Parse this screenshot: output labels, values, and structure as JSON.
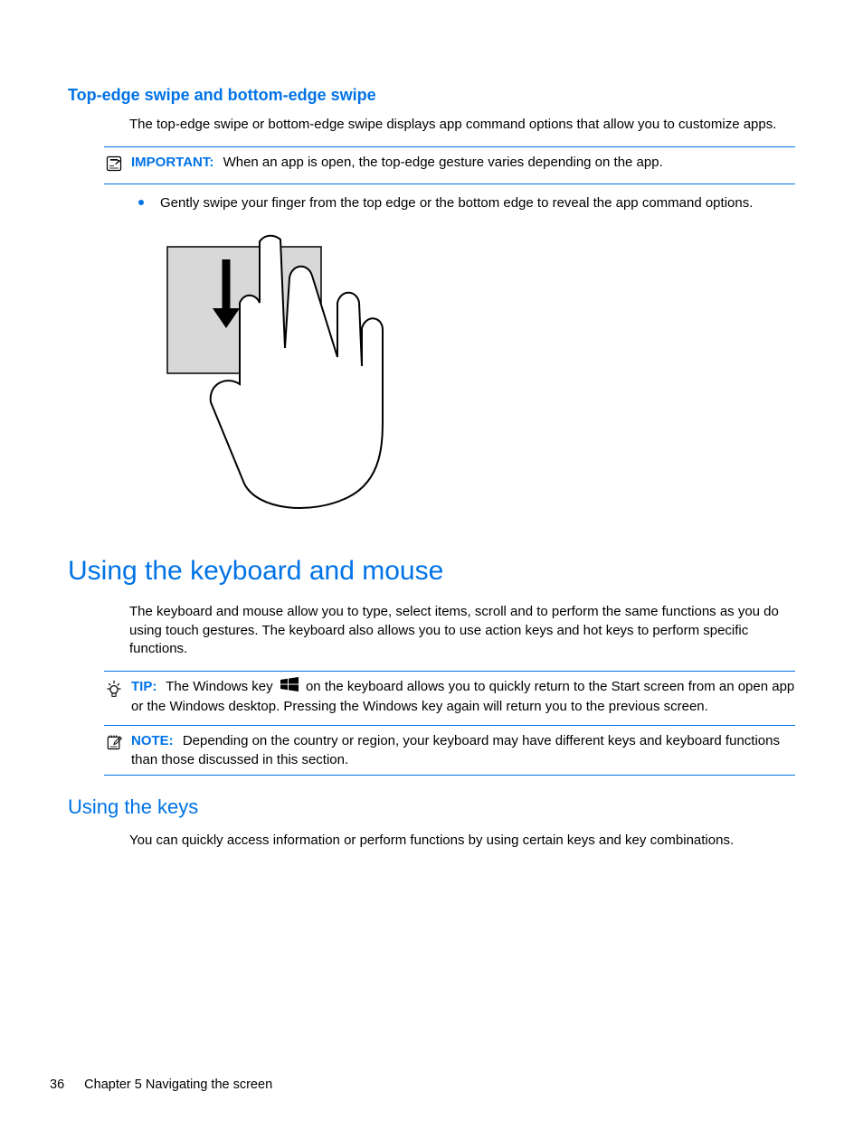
{
  "section1": {
    "title": "Top-edge swipe and bottom-edge swipe",
    "intro": "The top-edge swipe or bottom-edge swipe displays app command options that allow you to customize apps.",
    "important_label": "IMPORTANT:",
    "important_text": "When an app is open, the top-edge gesture varies depending on the app.",
    "bullet1": "Gently swipe your finger from the top edge or the bottom edge to reveal the app command options."
  },
  "section2": {
    "title": "Using the keyboard and mouse",
    "intro": "The keyboard and mouse allow you to type, select items, scroll and to perform the same functions as you do using touch gestures. The keyboard also allows you to use action keys and hot keys to perform specific functions.",
    "tip_label": "TIP:",
    "tip_text_a": "The Windows key",
    "tip_text_b": "on the keyboard allows you to quickly return to the Start screen from an open app or the Windows desktop. Pressing the Windows key again will return you to the previous screen.",
    "note_label": "NOTE:",
    "note_text": "Depending on the country or region, your keyboard may have different keys and keyboard functions than those discussed in this section."
  },
  "section3": {
    "title": "Using the keys",
    "intro": "You can quickly access information or perform functions by using certain keys and key combinations."
  },
  "footer": {
    "page": "36",
    "chapter": "Chapter 5   Navigating the screen"
  }
}
